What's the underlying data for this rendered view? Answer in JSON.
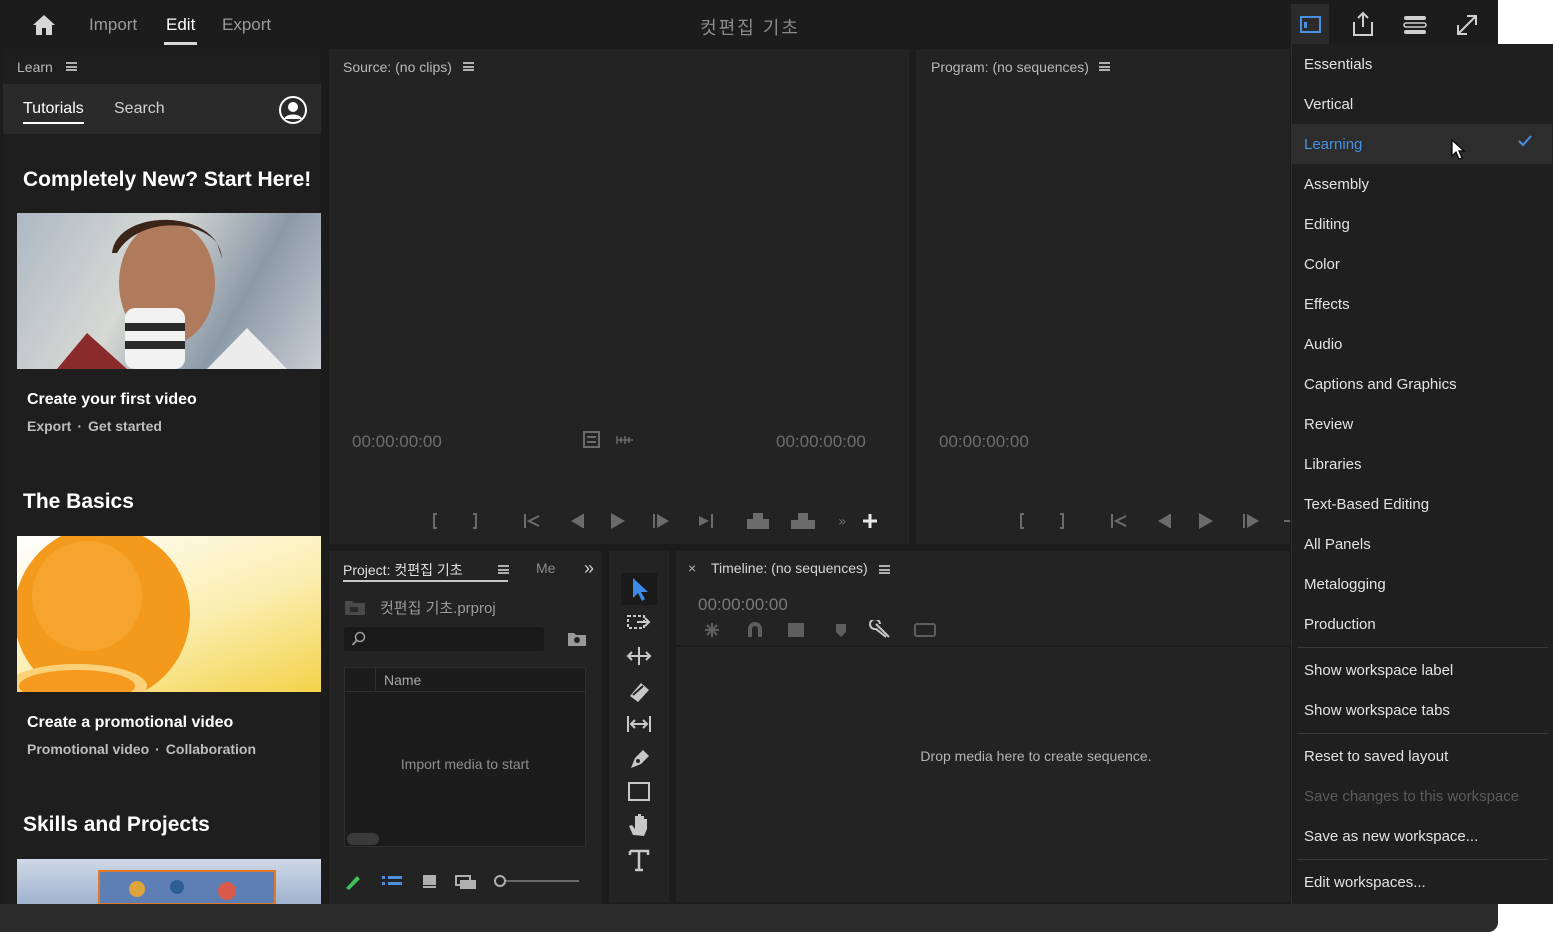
{
  "header": {
    "home_icon": "home-icon",
    "tabs": [
      {
        "label": "Import",
        "active": false
      },
      {
        "label": "Edit",
        "active": true
      },
      {
        "label": "Export",
        "active": false
      }
    ],
    "project_title": "컷편집 기초",
    "icons": [
      "workspaces-icon",
      "quick-export-icon",
      "progress-icon",
      "full-screen-icon"
    ]
  },
  "learn": {
    "title": "Learn",
    "tabs": {
      "tutorials": "Tutorials",
      "search": "Search"
    },
    "sections": [
      {
        "heading": "Completely New? Start Here!",
        "card_title": "Create your first video",
        "tags": [
          "Export",
          "Get started"
        ]
      },
      {
        "heading": "The Basics",
        "card_title": "Create a promotional video",
        "tags": [
          "Promotional video",
          "Collaboration"
        ]
      },
      {
        "heading": "Skills and Projects"
      }
    ]
  },
  "source": {
    "title": "Source: (no clips)",
    "timecode_in": "00:00:00:00",
    "timecode_out": "00:00:00:00"
  },
  "program": {
    "title": "Program: (no sequences)",
    "timecode_in": "00:00:00:00"
  },
  "project": {
    "title": "Project: 컷편집 기초",
    "next_tab": "Me",
    "file_name": "컷편집 기초.prproj",
    "search_placeholder": "",
    "column_name": "Name",
    "empty_text": "Import media to start"
  },
  "timeline": {
    "close": "×",
    "title": "Timeline: (no sequences)",
    "timecode": "00:00:00:00",
    "empty_text": "Drop media here to create sequence."
  },
  "workspace_menu": {
    "workspaces": [
      {
        "label": "Essentials",
        "state": "normal"
      },
      {
        "label": "Vertical",
        "state": "normal"
      },
      {
        "label": "Learning",
        "state": "active"
      },
      {
        "label": "Assembly",
        "state": "normal"
      },
      {
        "label": "Editing",
        "state": "normal"
      },
      {
        "label": "Color",
        "state": "normal"
      },
      {
        "label": "Effects",
        "state": "normal"
      },
      {
        "label": "Audio",
        "state": "normal"
      },
      {
        "label": "Captions and Graphics",
        "state": "normal"
      },
      {
        "label": "Review",
        "state": "normal"
      },
      {
        "label": "Libraries",
        "state": "normal"
      },
      {
        "label": "Text-Based Editing",
        "state": "normal"
      },
      {
        "label": "All Panels",
        "state": "normal"
      },
      {
        "label": "Metalogging",
        "state": "normal"
      },
      {
        "label": "Production",
        "state": "normal"
      }
    ],
    "options": [
      {
        "label": "Show workspace label",
        "state": "normal"
      },
      {
        "label": "Show workspace tabs",
        "state": "normal"
      }
    ],
    "actions": [
      {
        "label": "Reset to saved layout",
        "state": "normal"
      },
      {
        "label": "Save changes to this workspace",
        "state": "disabled"
      },
      {
        "label": "Save as new workspace...",
        "state": "normal"
      }
    ],
    "edit": "Edit workspaces...",
    "accent": "#4a90e2"
  },
  "colors": {
    "bg": "#1c1c1c",
    "panel": "#232323",
    "accent": "#4a90e2"
  }
}
